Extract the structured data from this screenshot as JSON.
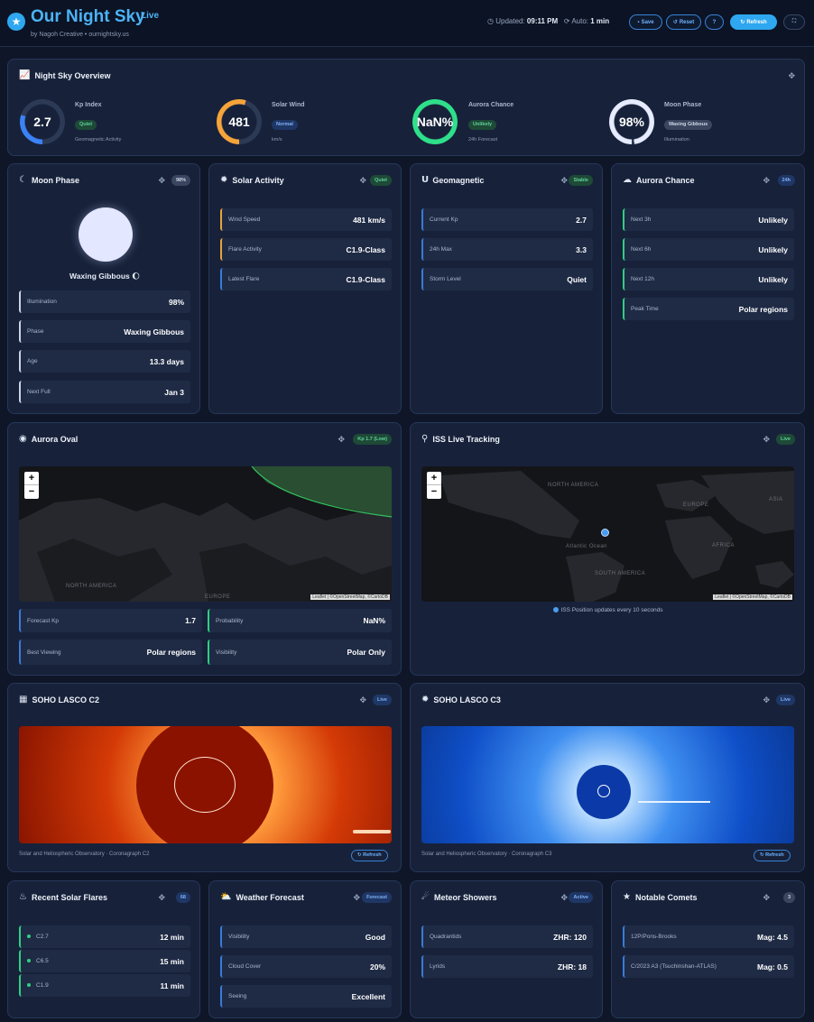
{
  "header": {
    "title": "Our Night Sky",
    "live": "Live",
    "byline": "by Nagoh Creative • ournightsky.us",
    "updated_label": "Updated:",
    "updated_time": "09:11 PM",
    "auto_label": "Auto:",
    "auto_value": "1 min",
    "save": "Save",
    "reset": "Reset",
    "help": "?",
    "refresh": "Refresh"
  },
  "overview": {
    "title": "Night Sky Overview",
    "kp": {
      "value": "2.7",
      "label": "Kp Index",
      "badge": "Quiet",
      "sub": "Geomagnetic Activity",
      "fill": 0.3
    },
    "wind": {
      "value": "481",
      "label": "Solar Wind",
      "badge": "Normal",
      "sub": "km/s",
      "fill": 0.55
    },
    "aurora": {
      "value": "NaN%",
      "label": "Aurora Chance",
      "badge": "Unlikely",
      "sub": "24h Forecast",
      "fill": 1.0
    },
    "moon": {
      "value": "98%",
      "label": "Moon Phase",
      "badge": "Waxing Gibbous",
      "sub": "Illumination",
      "fill": 0.98
    }
  },
  "moon": {
    "title": "Moon Phase",
    "badge": "98%",
    "name": "Waxing Gibbous",
    "emoji": "🌔",
    "rows": [
      {
        "label": "Illumination",
        "value": "98%"
      },
      {
        "label": "Phase",
        "value": "Waxing Gibbous"
      },
      {
        "label": "Age",
        "value": "13.3 days"
      },
      {
        "label": "Next Full",
        "value": "Jan 3"
      }
    ]
  },
  "solar": {
    "title": "Solar Activity",
    "badge": "Quiet",
    "rows": [
      {
        "label": "Wind Speed",
        "value": "481 km/s"
      },
      {
        "label": "Flare Activity",
        "value": "C1.9-Class"
      },
      {
        "label": "Latest Flare",
        "value": "C1.9-Class"
      }
    ]
  },
  "geo": {
    "title": "Geomagnetic",
    "badge": "Stable",
    "rows": [
      {
        "label": "Current Kp",
        "value": "2.7"
      },
      {
        "label": "24h Max",
        "value": "3.3"
      },
      {
        "label": "Storm Level",
        "value": "Quiet"
      }
    ]
  },
  "aurora": {
    "title": "Aurora Chance",
    "badge": "24h",
    "rows": [
      {
        "label": "Next 3h",
        "value": "Unlikely"
      },
      {
        "label": "Next 6h",
        "value": "Unlikely"
      },
      {
        "label": "Next 12h",
        "value": "Unlikely"
      },
      {
        "label": "Peak Time",
        "value": "Polar regions"
      }
    ]
  },
  "oval": {
    "title": "Aurora Oval",
    "badge": "Kp 1.7 (Low)",
    "attribution": "Leaflet | ©OpenStreetMap, ©CartoDB",
    "map_labels": {
      "na": "NORTH AMERICA",
      "eu": "EUROPE"
    },
    "stats": [
      {
        "label": "Forecast Kp",
        "value": "1.7"
      },
      {
        "label": "Probability",
        "value": "NaN%"
      },
      {
        "label": "Best Viewing",
        "value": "Polar regions"
      },
      {
        "label": "Visibility",
        "value": "Polar Only"
      }
    ]
  },
  "iss": {
    "title": "ISS Live Tracking",
    "badge": "Live",
    "attribution": "Leaflet | ©OpenStreetMap, ©CartoDB",
    "caption": "ISS Position updates every 10 seconds",
    "map_labels": {
      "na": "NORTH AMERICA",
      "europe": "EUROPE",
      "asia": "ASIA",
      "africa": "AFRICA",
      "sa": "SOUTH AMERICA",
      "atl": "Atlantic Ocean"
    }
  },
  "c2": {
    "title": "SOHO LASCO C2",
    "badge": "Live",
    "caption": "Solar and Heliospheric Observatory · Coronagraph C2",
    "refresh": "Refresh"
  },
  "c3": {
    "title": "SOHO LASCO C3",
    "badge": "Live",
    "caption": "Solar and Heliospheric Observatory · Coronagraph C3",
    "refresh": "Refresh"
  },
  "flares": {
    "title": "Recent Solar Flares",
    "badge": "68",
    "rows": [
      {
        "label": "C2.7",
        "value": "12 min"
      },
      {
        "label": "C6.5",
        "value": "15 min"
      },
      {
        "label": "C1.9",
        "value": "11 min"
      }
    ]
  },
  "weather": {
    "title": "Weather Forecast",
    "badge": "Forecast",
    "rows": [
      {
        "label": "Visibility",
        "value": "Good"
      },
      {
        "label": "Cloud Cover",
        "value": "20%"
      },
      {
        "label": "Seeing",
        "value": "Excellent"
      }
    ]
  },
  "meteors": {
    "title": "Meteor Showers",
    "badge": "Active",
    "rows": [
      {
        "label": "Quadrantids",
        "value": "ZHR: 120"
      },
      {
        "label": "Lyrids",
        "value": "ZHR: 18"
      }
    ]
  },
  "comets": {
    "title": "Notable Comets",
    "badge": "3",
    "rows": [
      {
        "label": "12P/Pons-Brooks",
        "value": "Mag: 4.5"
      },
      {
        "label": "C/2023 A3 (Tsuchinshan-ATLAS)",
        "value": "Mag: 0.5"
      }
    ]
  }
}
